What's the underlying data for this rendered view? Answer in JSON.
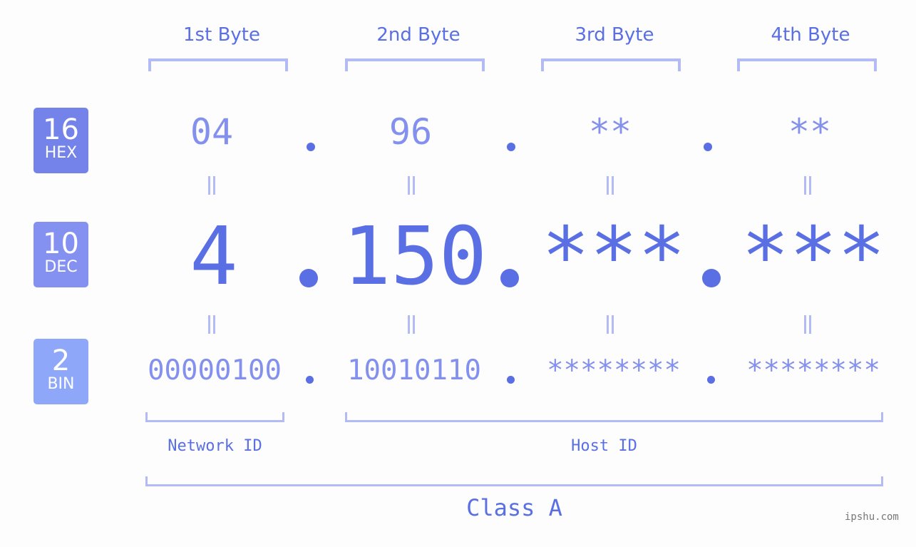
{
  "headers": [
    "1st Byte",
    "2nd Byte",
    "3rd Byte",
    "4th Byte"
  ],
  "badges": [
    {
      "num": "16",
      "label": "HEX",
      "color": "#7383ea"
    },
    {
      "num": "10",
      "label": "DEC",
      "color": "#8491f0"
    },
    {
      "num": "2",
      "label": "BIN",
      "color": "#8fa7f8"
    }
  ],
  "hex": [
    "04",
    "96",
    "**",
    "**"
  ],
  "dec": [
    "4",
    "150",
    "***",
    "***"
  ],
  "bin": [
    "00000100",
    "10010110",
    "********",
    "********"
  ],
  "labels": {
    "network": "Network ID",
    "host": "Host ID",
    "class": "Class A"
  },
  "watermark": "ipshu.com",
  "colors": {
    "accent": "#5a6fe4",
    "light": "#8490ee",
    "bracket": "#b3bbf5"
  }
}
